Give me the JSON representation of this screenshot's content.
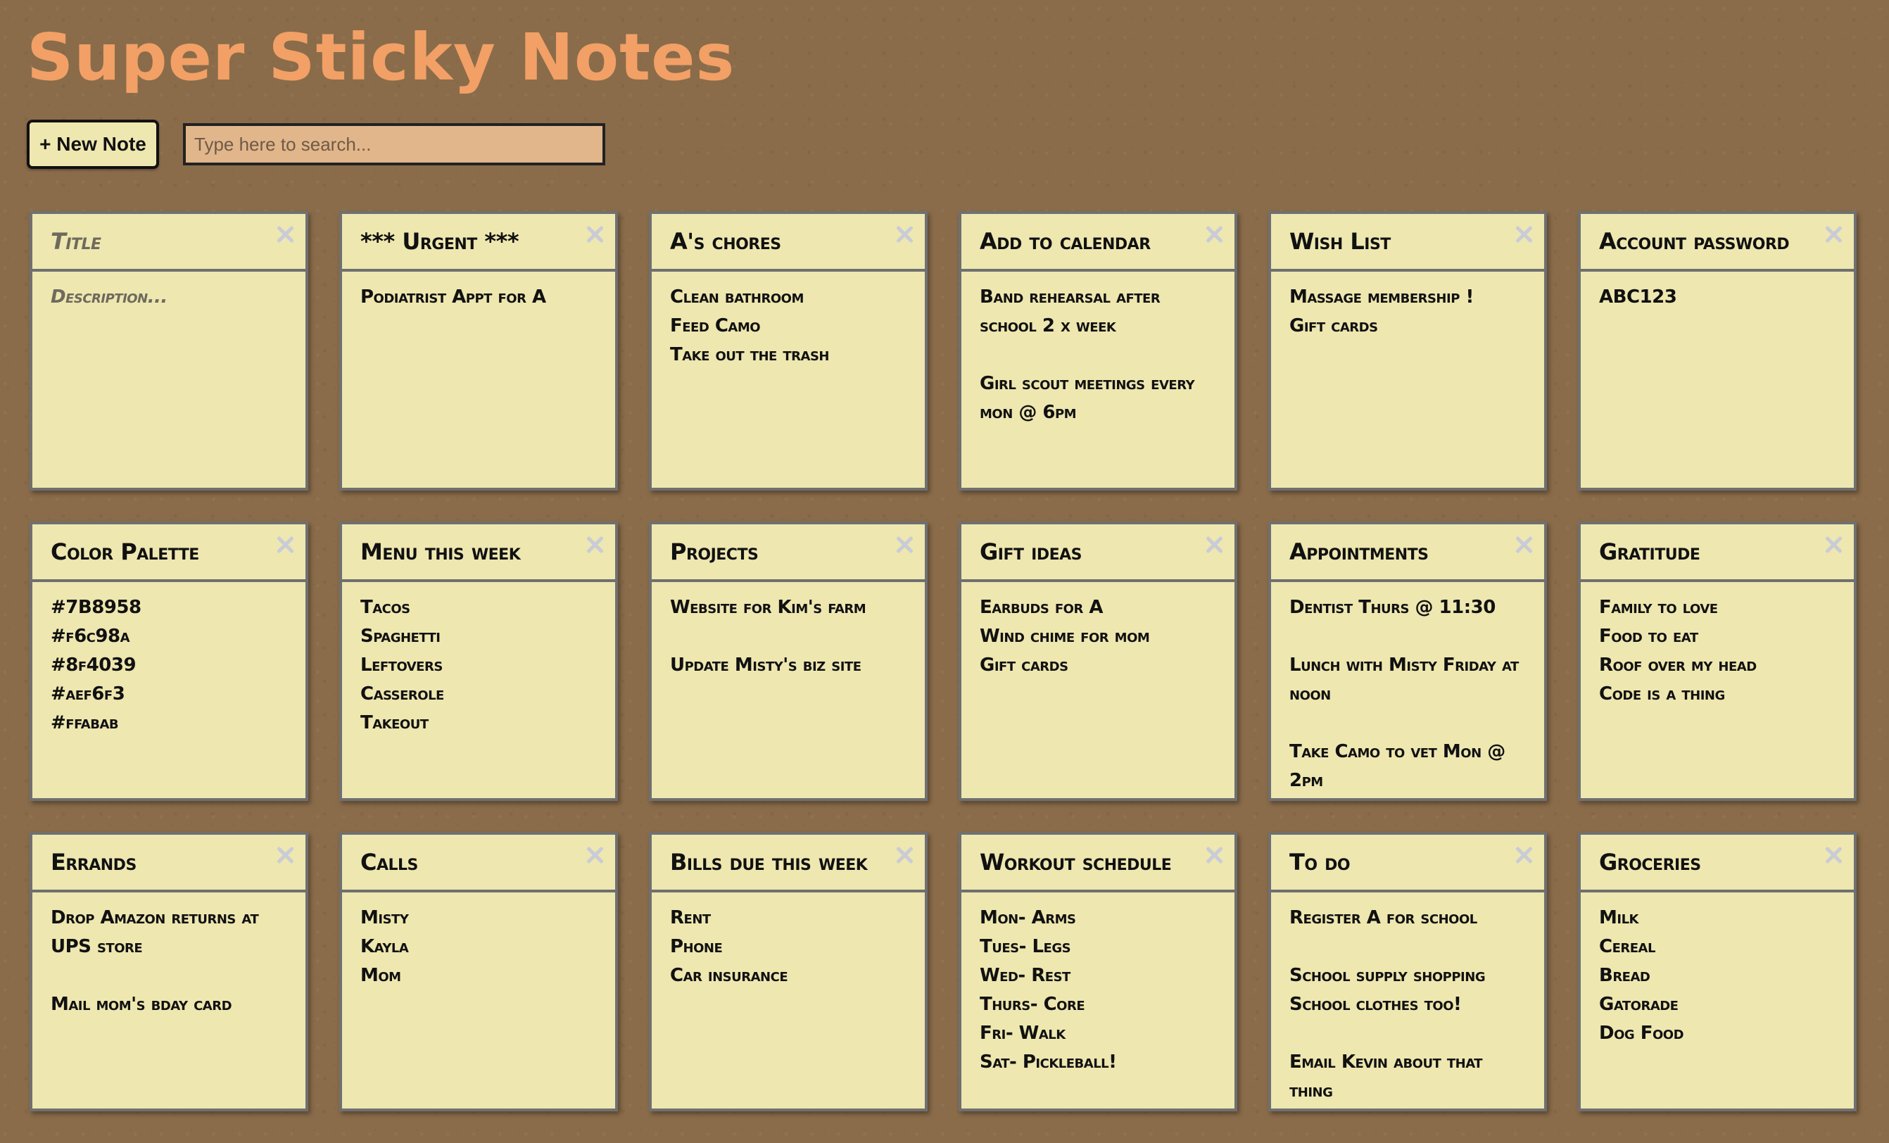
{
  "app": {
    "title": "Super Sticky Notes"
  },
  "toolbar": {
    "new_note_label": "+ New Note",
    "search_placeholder": "Type here to search...",
    "search_value": ""
  },
  "colors": {
    "background": "#8a6c4a",
    "title": "#f2a066",
    "note": "#eee7b0",
    "search_bg": "#e1b68a",
    "close_icon": "#c9ccd6"
  },
  "notes": [
    {
      "title": "",
      "title_placeholder": "Title",
      "description": "",
      "description_placeholder": "Description..."
    },
    {
      "title": "*** Urgent ***",
      "description": "Podiatrist Appt for A"
    },
    {
      "title": "A's chores",
      "description": "Clean bathroom\nFeed Camo\nTake out the trash"
    },
    {
      "title": "Add to calendar",
      "description": "Band rehearsal after school 2 x week\n\nGirl scout meetings every mon @ 6pm"
    },
    {
      "title": "Wish List",
      "description": "Massage membership !\nGift cards"
    },
    {
      "title": "Account password",
      "description": "ABC123"
    },
    {
      "title": "Color Palette",
      "description": "#7B8958\n#f6c98a\n#8f4039\n#aef6f3\n#ffabab"
    },
    {
      "title": "Menu this week",
      "description": "Tacos\nSpaghetti\nLeftovers\nCasserole\nTakeout"
    },
    {
      "title": "Projects",
      "description": "Website for Kim's farm\n\nUpdate Misty's biz site"
    },
    {
      "title": "Gift ideas",
      "description": "Earbuds for A\nWind chime for mom\nGift cards"
    },
    {
      "title": "Appointments",
      "description": "Dentist Thurs @ 11:30\n\nLunch with Misty Friday at noon\n\nTake Camo to vet Mon @ 2pm"
    },
    {
      "title": "Gratitude",
      "description": "Family to love\nFood to eat\nRoof over my head\nCode is a thing"
    },
    {
      "title": "Errands",
      "description": "Drop Amazon returns at UPS store\n\nMail mom's bday card"
    },
    {
      "title": "Calls",
      "description": "Misty\nKayla\nMom"
    },
    {
      "title": "Bills due this week",
      "description": "Rent\nPhone\nCar insurance"
    },
    {
      "title": "Workout schedule",
      "description": "Mon- Arms\nTues- Legs\nWed- Rest\nThurs- Core\nFri- Walk\nSat- Pickleball!"
    },
    {
      "title": "To do",
      "description": "Register A for school\n\nSchool supply shopping\nSchool clothes too!\n\nEmail Kevin about that thing"
    },
    {
      "title": "Groceries",
      "description": "Milk\nCereal\nBread\nGatorade\nDog Food"
    }
  ]
}
